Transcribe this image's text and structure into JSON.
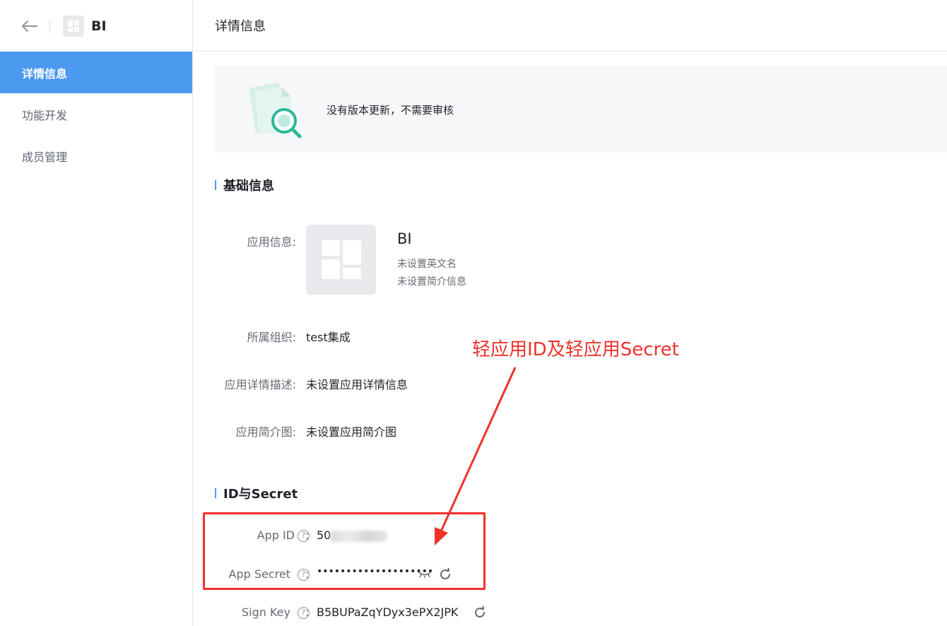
{
  "sidebar": {
    "app_name": "BI",
    "items": [
      {
        "label": "详情信息"
      },
      {
        "label": "功能开发"
      },
      {
        "label": "成员管理"
      }
    ]
  },
  "header": {
    "title": "详情信息"
  },
  "notice": {
    "text": "没有版本更新，不需要审核"
  },
  "basic_info": {
    "title": "基础信息",
    "app_info_label": "应用信息:",
    "app_name": "BI",
    "english_name": "未设置英文名",
    "brief": "未设置简介信息",
    "org_label": "所属组织:",
    "org_value": "test集成",
    "desc_label": "应用详情描述:",
    "desc_value": "未设置应用详情信息",
    "image_label": "应用简介图:",
    "image_value": "未设置应用简介图"
  },
  "id_secret": {
    "title": "ID与Secret",
    "app_id_label": "App ID",
    "app_id_prefix": "50",
    "app_secret_label": "App Secret",
    "app_secret_value": "••••••••••••••••••••",
    "sign_key_label": "Sign Key",
    "sign_key_value": "B5BUPaZqYDyx3ePX2JPK",
    "colon": ":",
    "help_glyph": "?"
  },
  "annotation": {
    "text": "轻应用ID及轻应用Secret",
    "color": "#f0322a"
  },
  "colors": {
    "accent": "#4c9af0",
    "annotation_red": "#f0322a"
  },
  "icons": [
    "back-arrow-icon",
    "app-grid-icon",
    "document-search-icon",
    "help-icon",
    "eye-closed-icon",
    "refresh-icon"
  ]
}
